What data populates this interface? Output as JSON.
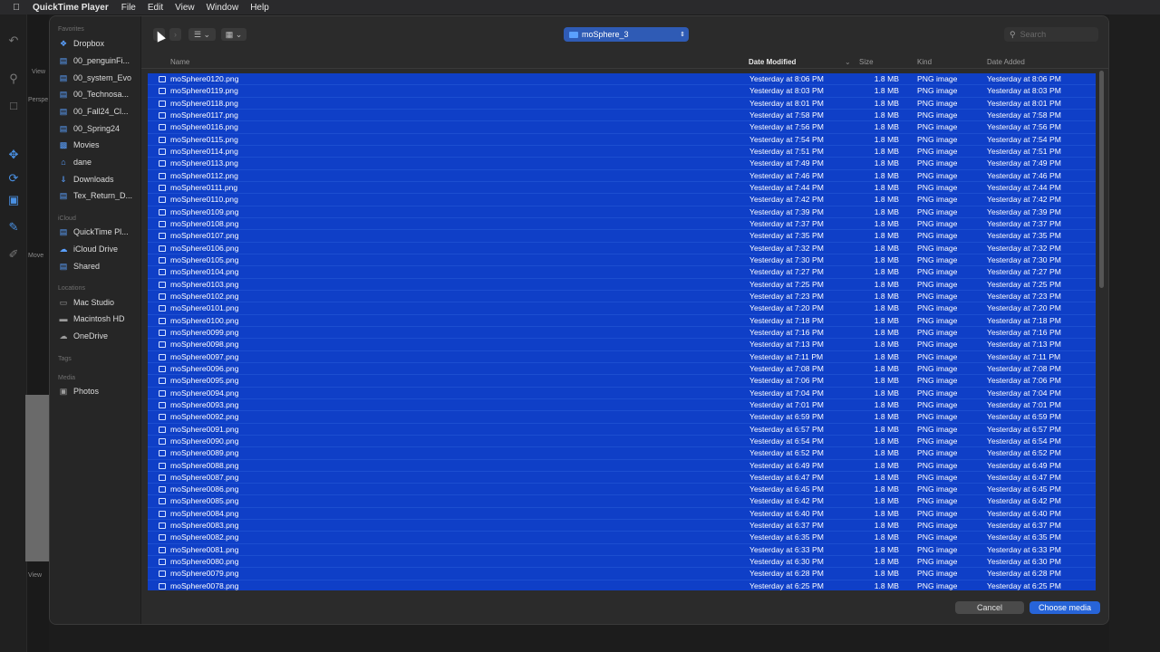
{
  "menubar": {
    "app_name": "QuickTime Player",
    "items": [
      "File",
      "Edit",
      "View",
      "Window",
      "Help"
    ]
  },
  "background_app": {
    "labels": [
      "View",
      "Perspe",
      "Move",
      "View"
    ]
  },
  "sidebar": {
    "favorites_label": "Favorites",
    "favorites": [
      {
        "label": "Dropbox",
        "icon": "dropbox-icon"
      },
      {
        "label": "00_penguinFi...",
        "icon": "folder-icon"
      },
      {
        "label": "00_system_Evo",
        "icon": "folder-icon"
      },
      {
        "label": "00_Technosa...",
        "icon": "folder-icon"
      },
      {
        "label": "00_Fall24_Cl...",
        "icon": "folder-icon"
      },
      {
        "label": "00_Spring24",
        "icon": "folder-icon"
      },
      {
        "label": "Movies",
        "icon": "movies-icon"
      },
      {
        "label": "dane",
        "icon": "home-icon"
      },
      {
        "label": "Downloads",
        "icon": "download-icon"
      },
      {
        "label": "Tex_Return_D...",
        "icon": "folder-icon"
      }
    ],
    "icloud_label": "iCloud",
    "icloud": [
      {
        "label": "QuickTime Pl...",
        "icon": "folder-icon"
      },
      {
        "label": "iCloud Drive",
        "icon": "cloud-icon"
      },
      {
        "label": "Shared",
        "icon": "shared-folder-icon"
      }
    ],
    "locations_label": "Locations",
    "locations": [
      {
        "label": "Mac Studio",
        "icon": "computer-icon"
      },
      {
        "label": "Macintosh HD",
        "icon": "disk-icon"
      },
      {
        "label": "OneDrive",
        "icon": "cloud-icon"
      }
    ],
    "tags_label": "Tags",
    "media_label": "Media",
    "media": [
      {
        "label": "Photos",
        "icon": "photos-icon"
      }
    ]
  },
  "toolbar": {
    "location": "moSphere_3",
    "search_placeholder": "Search"
  },
  "columns": {
    "name": "Name",
    "date_modified": "Date Modified",
    "size": "Size",
    "kind": "Kind",
    "date_added": "Date Added"
  },
  "files": [
    {
      "name": "moSphere0120.png",
      "date": "Yesterday at 8:06 PM",
      "size": "1.8 MB",
      "kind": "PNG image",
      "added": "Yesterday at 8:06 PM"
    },
    {
      "name": "moSphere0119.png",
      "date": "Yesterday at 8:03 PM",
      "size": "1.8 MB",
      "kind": "PNG image",
      "added": "Yesterday at 8:03 PM"
    },
    {
      "name": "moSphere0118.png",
      "date": "Yesterday at 8:01 PM",
      "size": "1.8 MB",
      "kind": "PNG image",
      "added": "Yesterday at 8:01 PM"
    },
    {
      "name": "moSphere0117.png",
      "date": "Yesterday at 7:58 PM",
      "size": "1.8 MB",
      "kind": "PNG image",
      "added": "Yesterday at 7:58 PM"
    },
    {
      "name": "moSphere0116.png",
      "date": "Yesterday at 7:56 PM",
      "size": "1.8 MB",
      "kind": "PNG image",
      "added": "Yesterday at 7:56 PM"
    },
    {
      "name": "moSphere0115.png",
      "date": "Yesterday at 7:54 PM",
      "size": "1.8 MB",
      "kind": "PNG image",
      "added": "Yesterday at 7:54 PM"
    },
    {
      "name": "moSphere0114.png",
      "date": "Yesterday at 7:51 PM",
      "size": "1.8 MB",
      "kind": "PNG image",
      "added": "Yesterday at 7:51 PM"
    },
    {
      "name": "moSphere0113.png",
      "date": "Yesterday at 7:49 PM",
      "size": "1.8 MB",
      "kind": "PNG image",
      "added": "Yesterday at 7:49 PM"
    },
    {
      "name": "moSphere0112.png",
      "date": "Yesterday at 7:46 PM",
      "size": "1.8 MB",
      "kind": "PNG image",
      "added": "Yesterday at 7:46 PM"
    },
    {
      "name": "moSphere0111.png",
      "date": "Yesterday at 7:44 PM",
      "size": "1.8 MB",
      "kind": "PNG image",
      "added": "Yesterday at 7:44 PM"
    },
    {
      "name": "moSphere0110.png",
      "date": "Yesterday at 7:42 PM",
      "size": "1.8 MB",
      "kind": "PNG image",
      "added": "Yesterday at 7:42 PM"
    },
    {
      "name": "moSphere0109.png",
      "date": "Yesterday at 7:39 PM",
      "size": "1.8 MB",
      "kind": "PNG image",
      "added": "Yesterday at 7:39 PM"
    },
    {
      "name": "moSphere0108.png",
      "date": "Yesterday at 7:37 PM",
      "size": "1.8 MB",
      "kind": "PNG image",
      "added": "Yesterday at 7:37 PM"
    },
    {
      "name": "moSphere0107.png",
      "date": "Yesterday at 7:35 PM",
      "size": "1.8 MB",
      "kind": "PNG image",
      "added": "Yesterday at 7:35 PM"
    },
    {
      "name": "moSphere0106.png",
      "date": "Yesterday at 7:32 PM",
      "size": "1.8 MB",
      "kind": "PNG image",
      "added": "Yesterday at 7:32 PM"
    },
    {
      "name": "moSphere0105.png",
      "date": "Yesterday at 7:30 PM",
      "size": "1.8 MB",
      "kind": "PNG image",
      "added": "Yesterday at 7:30 PM"
    },
    {
      "name": "moSphere0104.png",
      "date": "Yesterday at 7:27 PM",
      "size": "1.8 MB",
      "kind": "PNG image",
      "added": "Yesterday at 7:27 PM"
    },
    {
      "name": "moSphere0103.png",
      "date": "Yesterday at 7:25 PM",
      "size": "1.8 MB",
      "kind": "PNG image",
      "added": "Yesterday at 7:25 PM"
    },
    {
      "name": "moSphere0102.png",
      "date": "Yesterday at 7:23 PM",
      "size": "1.8 MB",
      "kind": "PNG image",
      "added": "Yesterday at 7:23 PM"
    },
    {
      "name": "moSphere0101.png",
      "date": "Yesterday at 7:20 PM",
      "size": "1.8 MB",
      "kind": "PNG image",
      "added": "Yesterday at 7:20 PM"
    },
    {
      "name": "moSphere0100.png",
      "date": "Yesterday at 7:18 PM",
      "size": "1.8 MB",
      "kind": "PNG image",
      "added": "Yesterday at 7:18 PM"
    },
    {
      "name": "moSphere0099.png",
      "date": "Yesterday at 7:16 PM",
      "size": "1.8 MB",
      "kind": "PNG image",
      "added": "Yesterday at 7:16 PM"
    },
    {
      "name": "moSphere0098.png",
      "date": "Yesterday at 7:13 PM",
      "size": "1.8 MB",
      "kind": "PNG image",
      "added": "Yesterday at 7:13 PM"
    },
    {
      "name": "moSphere0097.png",
      "date": "Yesterday at 7:11 PM",
      "size": "1.8 MB",
      "kind": "PNG image",
      "added": "Yesterday at 7:11 PM"
    },
    {
      "name": "moSphere0096.png",
      "date": "Yesterday at 7:08 PM",
      "size": "1.8 MB",
      "kind": "PNG image",
      "added": "Yesterday at 7:08 PM"
    },
    {
      "name": "moSphere0095.png",
      "date": "Yesterday at 7:06 PM",
      "size": "1.8 MB",
      "kind": "PNG image",
      "added": "Yesterday at 7:06 PM"
    },
    {
      "name": "moSphere0094.png",
      "date": "Yesterday at 7:04 PM",
      "size": "1.8 MB",
      "kind": "PNG image",
      "added": "Yesterday at 7:04 PM"
    },
    {
      "name": "moSphere0093.png",
      "date": "Yesterday at 7:01 PM",
      "size": "1.8 MB",
      "kind": "PNG image",
      "added": "Yesterday at 7:01 PM"
    },
    {
      "name": "moSphere0092.png",
      "date": "Yesterday at 6:59 PM",
      "size": "1.8 MB",
      "kind": "PNG image",
      "added": "Yesterday at 6:59 PM"
    },
    {
      "name": "moSphere0091.png",
      "date": "Yesterday at 6:57 PM",
      "size": "1.8 MB",
      "kind": "PNG image",
      "added": "Yesterday at 6:57 PM"
    },
    {
      "name": "moSphere0090.png",
      "date": "Yesterday at 6:54 PM",
      "size": "1.8 MB",
      "kind": "PNG image",
      "added": "Yesterday at 6:54 PM"
    },
    {
      "name": "moSphere0089.png",
      "date": "Yesterday at 6:52 PM",
      "size": "1.8 MB",
      "kind": "PNG image",
      "added": "Yesterday at 6:52 PM"
    },
    {
      "name": "moSphere0088.png",
      "date": "Yesterday at 6:49 PM",
      "size": "1.8 MB",
      "kind": "PNG image",
      "added": "Yesterday at 6:49 PM"
    },
    {
      "name": "moSphere0087.png",
      "date": "Yesterday at 6:47 PM",
      "size": "1.8 MB",
      "kind": "PNG image",
      "added": "Yesterday at 6:47 PM"
    },
    {
      "name": "moSphere0086.png",
      "date": "Yesterday at 6:45 PM",
      "size": "1.8 MB",
      "kind": "PNG image",
      "added": "Yesterday at 6:45 PM"
    },
    {
      "name": "moSphere0085.png",
      "date": "Yesterday at 6:42 PM",
      "size": "1.8 MB",
      "kind": "PNG image",
      "added": "Yesterday at 6:42 PM"
    },
    {
      "name": "moSphere0084.png",
      "date": "Yesterday at 6:40 PM",
      "size": "1.8 MB",
      "kind": "PNG image",
      "added": "Yesterday at 6:40 PM"
    },
    {
      "name": "moSphere0083.png",
      "date": "Yesterday at 6:37 PM",
      "size": "1.8 MB",
      "kind": "PNG image",
      "added": "Yesterday at 6:37 PM"
    },
    {
      "name": "moSphere0082.png",
      "date": "Yesterday at 6:35 PM",
      "size": "1.8 MB",
      "kind": "PNG image",
      "added": "Yesterday at 6:35 PM"
    },
    {
      "name": "moSphere0081.png",
      "date": "Yesterday at 6:33 PM",
      "size": "1.8 MB",
      "kind": "PNG image",
      "added": "Yesterday at 6:33 PM"
    },
    {
      "name": "moSphere0080.png",
      "date": "Yesterday at 6:30 PM",
      "size": "1.8 MB",
      "kind": "PNG image",
      "added": "Yesterday at 6:30 PM"
    },
    {
      "name": "moSphere0079.png",
      "date": "Yesterday at 6:28 PM",
      "size": "1.8 MB",
      "kind": "PNG image",
      "added": "Yesterday at 6:28 PM"
    },
    {
      "name": "moSphere0078.png",
      "date": "Yesterday at 6:25 PM",
      "size": "1.8 MB",
      "kind": "PNG image",
      "added": "Yesterday at 6:25 PM"
    }
  ],
  "buttons": {
    "cancel": "Cancel",
    "choose": "Choose media"
  },
  "colors": {
    "selection": "#0f3fc7",
    "accent": "#2764d8"
  }
}
